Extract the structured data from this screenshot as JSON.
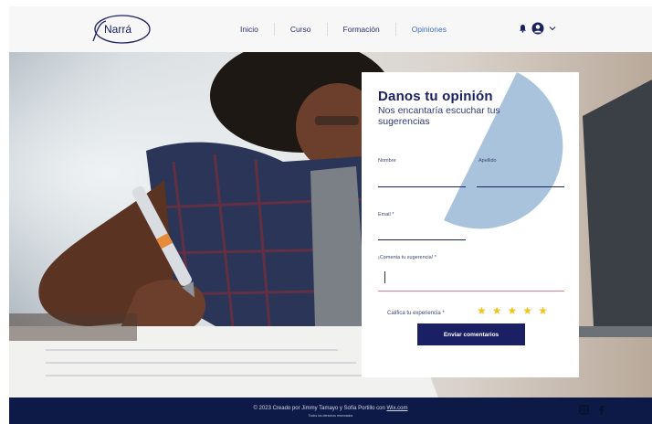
{
  "header": {
    "logo_text": "Narrá",
    "nav": [
      "Inicio",
      "Curso",
      "Formación",
      "Opiniones"
    ],
    "active_nav": "Opiniones"
  },
  "icons": {
    "notifications": "bell-icon",
    "account": "user-avatar-icon",
    "menu": "chevron-down-icon",
    "social": [
      "instagram-icon",
      "facebook-icon"
    ]
  },
  "form": {
    "title": "Danos tu opinión",
    "subtitle": "Nos encantaría escuchar tus sugerencias",
    "first_name_label": "Nombre",
    "last_name_label": "Apellido",
    "email_label": "Email *",
    "comment_label": "¡Comenta tu sugerencia! *",
    "rating_label": "Califica tu experiencia *",
    "rating_max": 5,
    "submit_label": "Enviar comentarios"
  },
  "footer": {
    "copyright_prefix": "© 2023 Creado por Jimmy Tamayo y Sofía Portillo con ",
    "copyright_link": "Wix.com",
    "rights": "Todos los derechos reservados"
  },
  "colors": {
    "brand_navy": "#1b1f63",
    "footer_navy": "#0d1a47",
    "accent_blue": "#3f6fc6",
    "shape_blue": "#a9c3dd",
    "star_yellow": "#f0c419",
    "error_pink": "#e07f85"
  }
}
